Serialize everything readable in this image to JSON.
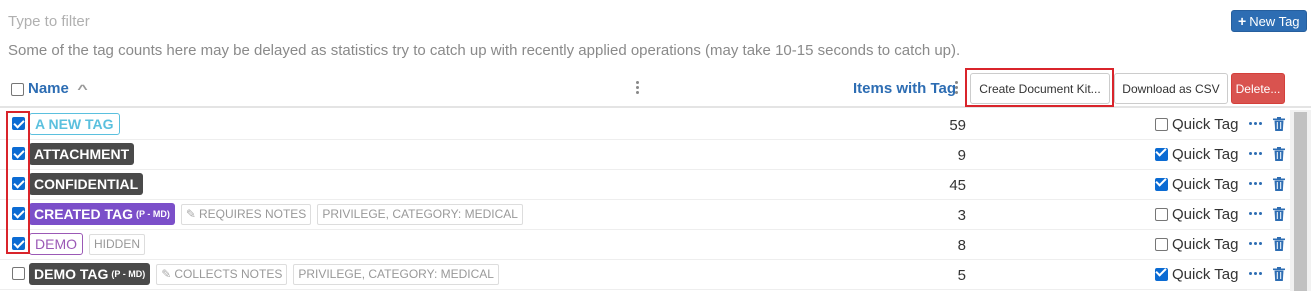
{
  "filter": {
    "placeholder": "Type to filter",
    "value": ""
  },
  "new_tag_label": "New Tag",
  "notice": "Some of the tag counts here may be delayed as statistics try to catch up with recently applied operations (may take 10-15 seconds to catch up).",
  "header": {
    "name_label": "Name",
    "items_label": "Items with Tag",
    "create_kit_label": "Create Document Kit...",
    "download_csv_label": "Download as CSV",
    "delete_label": "Delete..."
  },
  "rows": [
    {
      "tag": "A NEW TAG",
      "suffix": "",
      "checked": true,
      "count": "59",
      "quick_tag": false,
      "quick_label": "Quick Tag",
      "chips": []
    },
    {
      "tag": "ATTACHMENT",
      "suffix": "",
      "checked": true,
      "count": "9",
      "quick_tag": true,
      "quick_label": "Quick Tag",
      "chips": []
    },
    {
      "tag": "CONFIDENTIAL",
      "suffix": "",
      "checked": true,
      "count": "45",
      "quick_tag": true,
      "quick_label": "Quick Tag",
      "chips": []
    },
    {
      "tag": "CREATED TAG",
      "suffix": "(P - MD)",
      "checked": true,
      "count": "3",
      "quick_tag": false,
      "quick_label": "Quick Tag",
      "chips": [
        "REQUIRES NOTES",
        "PRIVILEGE, CATEGORY: MEDICAL"
      ]
    },
    {
      "tag": "DEMO",
      "suffix": "",
      "checked": true,
      "count": "8",
      "quick_tag": false,
      "quick_label": "Quick Tag",
      "chips": [
        "HIDDEN"
      ]
    },
    {
      "tag": "DEMO TAG",
      "suffix": "(P - MD)",
      "checked": false,
      "count": "5",
      "quick_tag": true,
      "quick_label": "Quick Tag",
      "chips": [
        "COLLECTS NOTES",
        "PRIVILEGE, CATEGORY: MEDICAL"
      ]
    }
  ],
  "colors": {
    "accent": "#2d6db3",
    "danger": "#d9534f",
    "highlight_outline": "#d9242b",
    "tag_a_new_tag": "#5bc0de",
    "tag_dark": "#4a4a4a",
    "tag_created": "#7b4fc9",
    "tag_demo": "#9b59b6"
  }
}
